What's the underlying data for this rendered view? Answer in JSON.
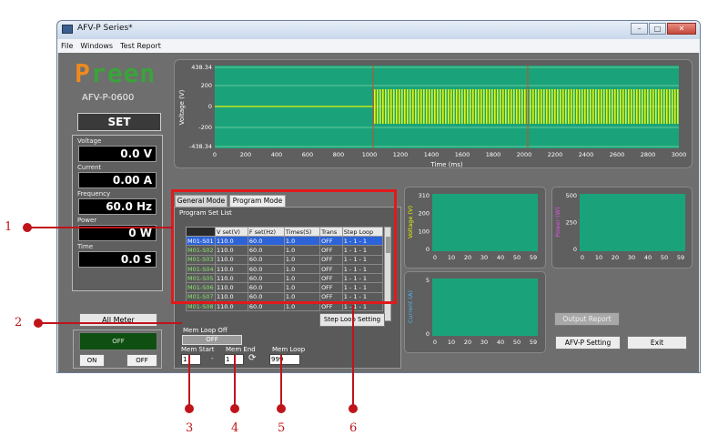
{
  "window": {
    "title": "AFV-P Series*",
    "menus": [
      "File",
      "Windows",
      "Test Report"
    ]
  },
  "logo": {
    "brand_p": "P",
    "brand_rest": "reen",
    "model": "AFV-P-0600"
  },
  "set_panel": {
    "set_label": "SET",
    "meters": [
      {
        "label": "Voltage",
        "value": "0.0 V"
      },
      {
        "label": "Current",
        "value": "0.00 A"
      },
      {
        "label": "Frequency",
        "value": "60.0 Hz"
      },
      {
        "label": "Power",
        "value": "0 W"
      },
      {
        "label": "Time",
        "value": "0.0 S"
      }
    ],
    "all_meter": "All Meter",
    "output_state": "OFF",
    "on_button": "ON",
    "off_button": "OFF"
  },
  "voltage_chart": {
    "ylabel": "Voltage (V)",
    "xlabel": "Time (ms)",
    "yticks": [
      "438.34",
      "200",
      "0",
      "-200",
      "-438.34"
    ],
    "xticks": [
      "0",
      "200",
      "400",
      "600",
      "800",
      "1000",
      "1200",
      "1400",
      "1600",
      "1800",
      "2000",
      "2200",
      "2400",
      "2600",
      "2800",
      "3000"
    ]
  },
  "tabs": {
    "general": "General Mode",
    "program": "Program Mode"
  },
  "program_list": {
    "title": "Program Set List",
    "headers": [
      "V set(V)",
      "F set(Hz)",
      "Times(S)",
      "Trans",
      "Step Loop"
    ],
    "rows": [
      {
        "id": "M01-S01",
        "v": "110.0",
        "f": "60.0",
        "t": "1.0",
        "trans": "OFF",
        "loop": "1 - 1 - 1"
      },
      {
        "id": "M01-S02",
        "v": "110.0",
        "f": "60.0",
        "t": "1.0",
        "trans": "OFF",
        "loop": "1 - 1 - 1"
      },
      {
        "id": "M01-S03",
        "v": "110.0",
        "f": "60.0",
        "t": "1.0",
        "trans": "OFF",
        "loop": "1 - 1 - 1"
      },
      {
        "id": "M01-S04",
        "v": "110.0",
        "f": "60.0",
        "t": "1.0",
        "trans": "OFF",
        "loop": "1 - 1 - 1"
      },
      {
        "id": "M01-S05",
        "v": "110.0",
        "f": "60.0",
        "t": "1.0",
        "trans": "OFF",
        "loop": "1 - 1 - 1"
      },
      {
        "id": "M01-S06",
        "v": "110.0",
        "f": "60.0",
        "t": "1.0",
        "trans": "OFF",
        "loop": "1 - 1 - 1"
      },
      {
        "id": "M01-S07",
        "v": "110.0",
        "f": "60.0",
        "t": "1.0",
        "trans": "OFF",
        "loop": "1 - 1 - 1"
      },
      {
        "id": "M01-S08",
        "v": "110.0",
        "f": "60.0",
        "t": "1.0",
        "trans": "OFF",
        "loop": "1 - 1 - 1"
      }
    ]
  },
  "mem_loop": {
    "title": "Mem Loop Off",
    "state": "OFF",
    "start_label": "Mem Start",
    "end_label": "Mem End",
    "loop_label": "Mem Loop",
    "start_value": "1",
    "end_value": "1",
    "loop_value": "999",
    "dash": "-"
  },
  "step_loop_setting": "Step Loop Setting",
  "small_charts": {
    "voltage": {
      "ylabel": "Voltage (V)",
      "yticks": [
        "310",
        "200",
        "100",
        "0"
      ]
    },
    "power": {
      "ylabel": "Power (W)",
      "yticks": [
        "500",
        "250",
        "0"
      ]
    },
    "current": {
      "ylabel": "Current (A)",
      "yticks": [
        "5",
        "0"
      ]
    },
    "xticks": [
      "0",
      "10",
      "20",
      "30",
      "40",
      "50",
      "59"
    ]
  },
  "buttons": {
    "output_report": "Output Report",
    "afv_setting": "AFV-P Setting",
    "exit": "Exit"
  },
  "callouts": [
    "1",
    "2",
    "3",
    "4",
    "5",
    "6"
  ],
  "colors": {
    "accent_red": "#e2191b",
    "plot_green": "#1aa37a",
    "wave_yellow": "#e8f20a",
    "grid_green": "#7fd9a7"
  }
}
